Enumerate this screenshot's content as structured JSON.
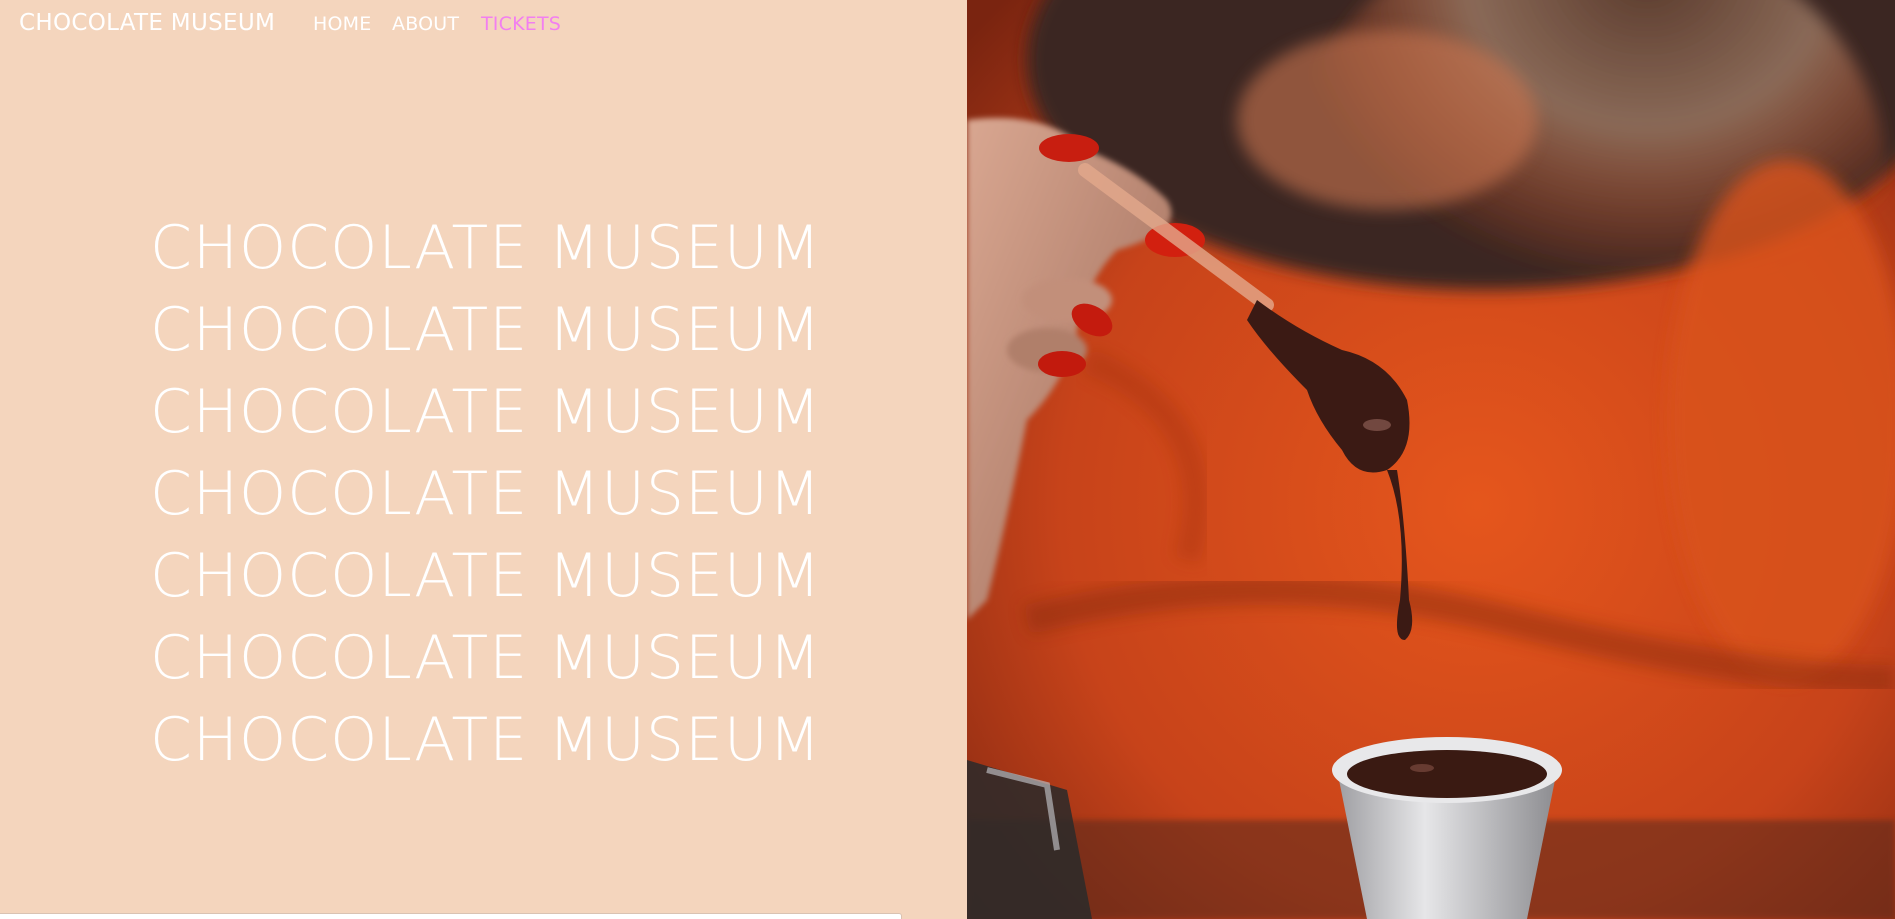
{
  "nav": {
    "brand": "CHOCOLATE MUSEUM",
    "links": [
      {
        "label": "HOME"
      },
      {
        "label": "ABOUT"
      },
      {
        "label": "TICKETS"
      }
    ],
    "active_color": "#f27ff0"
  },
  "hero": {
    "lines": [
      "CHOCOLATE MUSEUM",
      "CHOCOLATE MUSEUM",
      "CHOCOLATE MUSEUM",
      "CHOCOLATE MUSEUM",
      "CHOCOLATE MUSEUM",
      "CHOCOLATE MUSEUM",
      "CHOCOLATE MUSEUM"
    ]
  },
  "colors": {
    "background": "#f4d5bd",
    "text": "#ffffff"
  },
  "photo": {
    "subject": "hand-with-chocolate-spoon-photo"
  }
}
